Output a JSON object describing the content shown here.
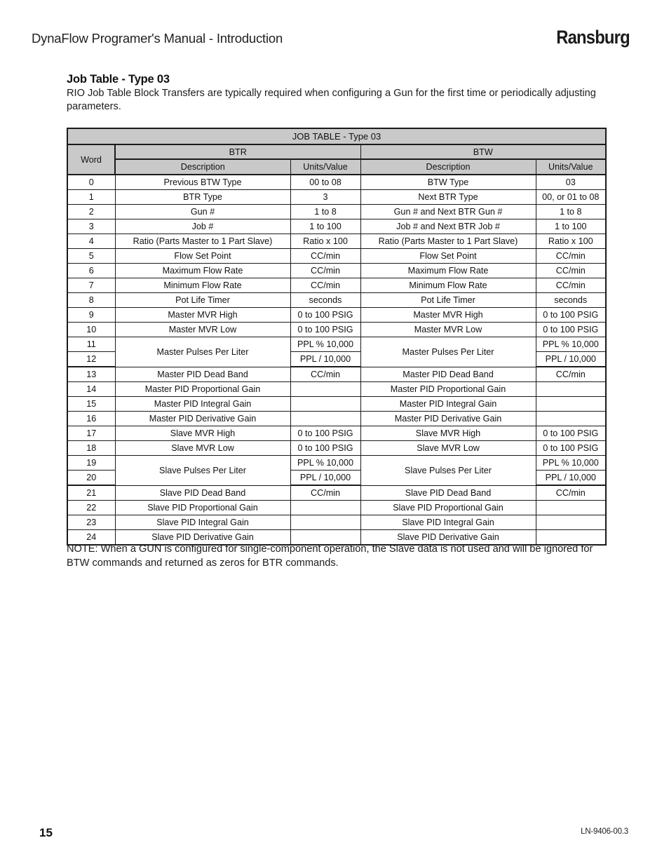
{
  "header": {
    "title": "DynaFlow Programer's Manual - Introduction",
    "brand": "Ransburg"
  },
  "section": {
    "title": "Job Table - Type 03",
    "intro": "RIO Job Table Block Transfers are typically required when configuring a Gun for the first time or periodically adjusting parameters."
  },
  "table": {
    "caption": "JOB TABLE - Type 03",
    "group_headers": {
      "word": "Word",
      "btr": "BTR",
      "btw": "BTW"
    },
    "sub_headers": {
      "description": "Description",
      "units_value": "Units/Value"
    },
    "rows": [
      {
        "word": "0",
        "btr_desc": "Previous BTW Type",
        "btr_units": "00 to 08",
        "btw_desc": "BTW Type",
        "btw_units": "03"
      },
      {
        "word": "1",
        "btr_desc": "BTR Type",
        "btr_units": "3",
        "btw_desc": "Next BTR Type",
        "btw_units": "00, or 01 to 08"
      },
      {
        "word": "2",
        "btr_desc": "Gun #",
        "btr_units": "1 to 8",
        "btw_desc": "Gun # and Next BTR Gun #",
        "btw_units": "1 to 8"
      },
      {
        "word": "3",
        "btr_desc": "Job #",
        "btr_units": "1 to 100",
        "btw_desc": "Job # and Next BTR Job #",
        "btw_units": "1 to 100"
      },
      {
        "word": "4",
        "btr_desc": "Ratio (Parts Master to 1 Part Slave)",
        "btr_units": "Ratio x 100",
        "btw_desc": "Ratio (Parts Master to 1 Part Slave)",
        "btw_units": "Ratio x 100"
      },
      {
        "word": "5",
        "btr_desc": "Flow Set Point",
        "btr_units": "CC/min",
        "btw_desc": "Flow Set Point",
        "btw_units": "CC/min"
      },
      {
        "word": "6",
        "btr_desc": "Maximum Flow Rate",
        "btr_units": "CC/min",
        "btw_desc": "Maximum Flow Rate",
        "btw_units": "CC/min"
      },
      {
        "word": "7",
        "btr_desc": "Minimum Flow Rate",
        "btr_units": "CC/min",
        "btw_desc": "Minimum Flow Rate",
        "btw_units": "CC/min"
      },
      {
        "word": "8",
        "btr_desc": "Pot Life Timer",
        "btr_units": "seconds",
        "btw_desc": "Pot Life Timer",
        "btw_units": "seconds"
      },
      {
        "word": "9",
        "btr_desc": "Master MVR High",
        "btr_units": "0 to 100 PSIG",
        "btw_desc": "Master MVR High",
        "btw_units": "0 to 100 PSIG"
      },
      {
        "word": "10",
        "btr_desc": "Master MVR Low",
        "btr_units": "0 to 100 PSIG",
        "btw_desc": "Master MVR Low",
        "btw_units": "0 to 100 PSIG"
      },
      {
        "word": "11",
        "btr_desc": "Master Pulses Per Liter",
        "btr_units": "PPL % 10,000",
        "btw_desc": "Master Pulses Per Liter",
        "btw_units": "PPL % 10,000",
        "merge_desc_start": true
      },
      {
        "word": "12",
        "btr_desc": "",
        "btr_units": "PPL / 10,000",
        "btw_desc": "",
        "btw_units": "PPL / 10,000",
        "merge_desc_cont": true
      },
      {
        "word": "13",
        "btr_desc": "Master PID Dead Band",
        "btr_units": "CC/min",
        "btw_desc": "Master PID Dead Band",
        "btw_units": "CC/min"
      },
      {
        "word": "14",
        "btr_desc": "Master PID Proportional Gain",
        "btr_units": "",
        "btw_desc": "Master PID Proportional Gain",
        "btw_units": ""
      },
      {
        "word": "15",
        "btr_desc": "Master PID Integral Gain",
        "btr_units": "",
        "btw_desc": "Master PID Integral Gain",
        "btw_units": ""
      },
      {
        "word": "16",
        "btr_desc": "Master PID Derivative Gain",
        "btr_units": "",
        "btw_desc": "Master PID Derivative Gain",
        "btw_units": ""
      },
      {
        "word": "17",
        "btr_desc": "Slave MVR High",
        "btr_units": "0 to 100 PSIG",
        "btw_desc": "Slave MVR High",
        "btw_units": "0 to 100 PSIG"
      },
      {
        "word": "18",
        "btr_desc": "Slave MVR Low",
        "btr_units": "0 to 100 PSIG",
        "btw_desc": "Slave MVR Low",
        "btw_units": "0 to 100 PSIG"
      },
      {
        "word": "19",
        "btr_desc": "Slave Pulses Per Liter",
        "btr_units": "PPL % 10,000",
        "btw_desc": "Slave Pulses Per Liter",
        "btw_units": "PPL % 10,000",
        "merge_desc_start": true
      },
      {
        "word": "20",
        "btr_desc": "",
        "btr_units": "PPL / 10,000",
        "btw_desc": "",
        "btw_units": "PPL / 10,000",
        "merge_desc_cont": true
      },
      {
        "word": "21",
        "btr_desc": "Slave PID Dead Band",
        "btr_units": "CC/min",
        "btw_desc": "Slave PID Dead Band",
        "btw_units": "CC/min"
      },
      {
        "word": "22",
        "btr_desc": "Slave PID Proportional Gain",
        "btr_units": "",
        "btw_desc": "Slave PID Proportional Gain",
        "btw_units": ""
      },
      {
        "word": "23",
        "btr_desc": "Slave PID Integral Gain",
        "btr_units": "",
        "btw_desc": "Slave PID Integral Gain",
        "btw_units": ""
      },
      {
        "word": "24",
        "btr_desc": "Slave PID Derivative Gain",
        "btr_units": "",
        "btw_desc": "Slave PID Derivative Gain",
        "btw_units": ""
      }
    ]
  },
  "note": "NOTE: When a GUN is configured for single-component operation, the Slave data is not used and will be ignored for BTW commands and returned as zeros for BTR commands.",
  "footer": {
    "page_number": "15",
    "doc_code": "LN-9406-00.3"
  }
}
